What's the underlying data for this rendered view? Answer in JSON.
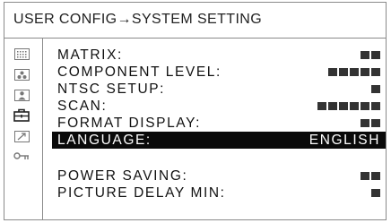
{
  "header": {
    "title": "USER CONFIG→SYSTEM SETTING"
  },
  "sidebar": {
    "icons": [
      "matrix-grid-icon",
      "color-dots-icon",
      "person-icon",
      "toolbox-icon",
      "arrow-icon",
      "key-icon"
    ]
  },
  "menu": {
    "items": [
      {
        "label": "MATRIX:",
        "bars": 2,
        "value": ""
      },
      {
        "label": "COMPONENT LEVEL:",
        "bars": 5,
        "value": ""
      },
      {
        "label": "NTSC SETUP:",
        "bars": 1,
        "value": ""
      },
      {
        "label": "SCAN:",
        "bars": 6,
        "value": ""
      },
      {
        "label": "FORMAT DISPLAY:",
        "bars": 2,
        "value": ""
      },
      {
        "label": "LANGUAGE:",
        "bars": 0,
        "value": "ENGLISH",
        "selected": true
      },
      {
        "label": "POWER SAVING:",
        "bars": 2,
        "value": ""
      },
      {
        "label": "PICTURE DELAY MIN:",
        "bars": 1,
        "value": ""
      }
    ]
  },
  "colors": {
    "selection_background": "#0a0a0a",
    "selection_text": "#ffffff",
    "frame_border": "#8a8a8a",
    "bar_fill": "#333333"
  }
}
